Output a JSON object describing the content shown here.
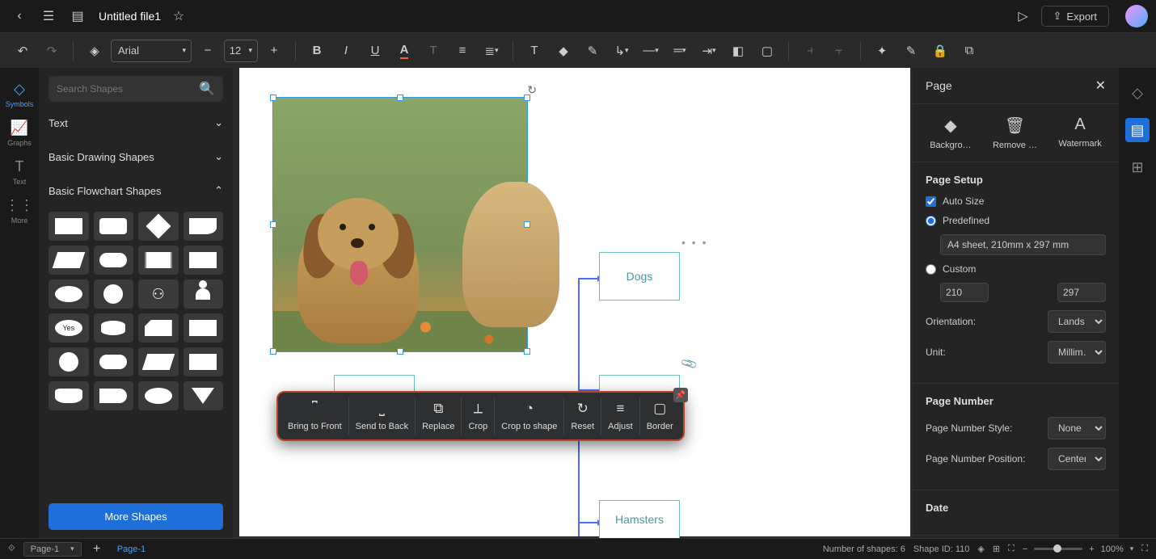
{
  "header": {
    "filename": "Untitled file1",
    "export_label": "Export"
  },
  "toolbar": {
    "font_family": "Arial",
    "font_size": "12"
  },
  "left_rail": {
    "items": [
      "Symbols",
      "Graphs",
      "Text",
      "More"
    ]
  },
  "shapes_panel": {
    "search_placeholder": "Search Shapes",
    "categories": {
      "text": "Text",
      "basic_drawing": "Basic Drawing Shapes",
      "basic_flowchart": "Basic Flowchart Shapes"
    },
    "yes_label": "Yes",
    "more_shapes_btn": "More Shapes"
  },
  "canvas": {
    "boxes": {
      "dogs": "Dogs",
      "hamsters": "Hamsters"
    }
  },
  "image_toolbar": {
    "items": [
      {
        "id": "bring-to-front",
        "label": "Bring to Front",
        "icon": "⬆"
      },
      {
        "id": "send-to-back",
        "label": "Send to Back",
        "icon": "⬇"
      },
      {
        "id": "replace",
        "label": "Replace",
        "icon": "⧉"
      },
      {
        "id": "crop",
        "label": "Crop",
        "icon": "✂"
      },
      {
        "id": "crop-to-shape",
        "label": "Crop to shape",
        "icon": "◔"
      },
      {
        "id": "reset",
        "label": "Reset",
        "icon": "↻"
      },
      {
        "id": "adjust",
        "label": "Adjust",
        "icon": "≡"
      },
      {
        "id": "border",
        "label": "Border",
        "icon": "▢"
      }
    ]
  },
  "right_panel": {
    "title": "Page",
    "actions": {
      "background": "Backgro…",
      "remove": "Remove …",
      "watermark": "Watermark"
    },
    "page_setup": {
      "heading": "Page Setup",
      "auto_size": "Auto Size",
      "predefined": "Predefined",
      "predefined_value": "A4 sheet, 210mm x 297 mm",
      "custom": "Custom",
      "width": "210",
      "height": "297",
      "orientation_label": "Orientation:",
      "orientation_value": "Lands…",
      "unit_label": "Unit:",
      "unit_value": "Millim…"
    },
    "page_number": {
      "heading": "Page Number",
      "style_label": "Page Number Style:",
      "style_value": "None",
      "position_label": "Page Number Position:",
      "position_value": "Center"
    },
    "date_heading": "Date"
  },
  "statusbar": {
    "page_selector": "Page-1",
    "active_tab": "Page-1",
    "shapes_count": "Number of shapes: 6",
    "shape_id": "Shape ID: 110",
    "zoom": "100%"
  }
}
